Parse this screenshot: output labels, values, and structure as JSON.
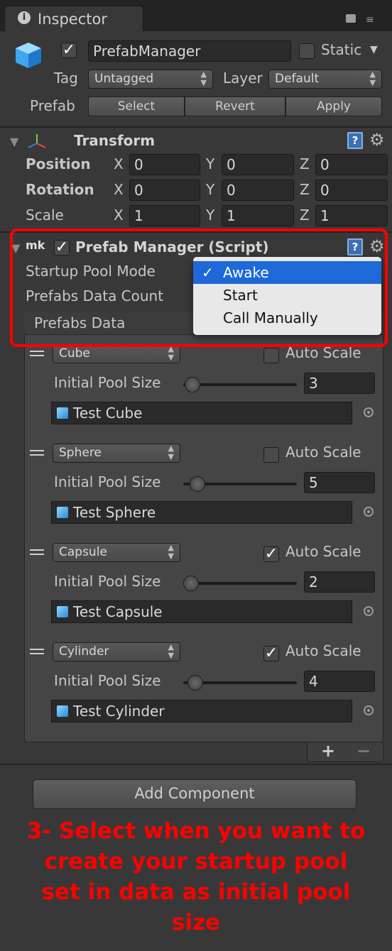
{
  "tab": {
    "title": "Inspector"
  },
  "header": {
    "object_name": "PrefabManager",
    "active_checked": true,
    "static_label": "Static",
    "tag_label": "Tag",
    "tag_value": "Untagged",
    "layer_label": "Layer",
    "layer_value": "Default",
    "prefab_label": "Prefab",
    "prefab_buttons": [
      "Select",
      "Revert",
      "Apply"
    ]
  },
  "transform": {
    "title": "Transform",
    "rows": [
      {
        "label": "Position",
        "x": "0",
        "y": "0",
        "z": "0"
      },
      {
        "label": "Rotation",
        "x": "0",
        "y": "0",
        "z": "0"
      },
      {
        "label": "Scale",
        "x": "1",
        "y": "1",
        "z": "1"
      }
    ],
    "axis": {
      "x": "X",
      "y": "Y",
      "z": "Z"
    }
  },
  "script_component": {
    "title": "Prefab Manager (Script)",
    "startup_label": "Startup Pool Mode",
    "count_label": "Prefabs Data Count",
    "list_title": "Prefabs Data",
    "dropdown_options": [
      "Awake",
      "Start",
      "Call Manually"
    ],
    "dropdown_selected": "Awake"
  },
  "entries": [
    {
      "type": "Cube",
      "auto_scale_label": "Auto Scale",
      "auto_scale": false,
      "pool_label": "Initial Pool Size",
      "pool_size": "3",
      "pool_fraction": 0.06,
      "prefab": "Test Cube"
    },
    {
      "type": "Sphere",
      "auto_scale_label": "Auto Scale",
      "auto_scale": false,
      "pool_label": "Initial Pool Size",
      "pool_size": "5",
      "pool_fraction": 0.1,
      "prefab": "Test Sphere"
    },
    {
      "type": "Capsule",
      "auto_scale_label": "Auto Scale",
      "auto_scale": true,
      "pool_label": "Initial Pool Size",
      "pool_size": "2",
      "pool_fraction": 0.04,
      "prefab": "Test Capsule"
    },
    {
      "type": "Cylinder",
      "auto_scale_label": "Auto Scale",
      "auto_scale": true,
      "pool_label": "Initial Pool Size",
      "pool_size": "4",
      "pool_fraction": 0.08,
      "prefab": "Test Cylinder"
    }
  ],
  "list_footer": {
    "add": "+",
    "remove": "−"
  },
  "add_component": "Add Component",
  "caption": {
    "lines": [
      "3- Select when you want to",
      "create your startup pool",
      "set in data as initial pool",
      "size"
    ]
  },
  "colors": {
    "highlight": "#ff0000",
    "selection": "#1e68d8",
    "panel": "#383838"
  }
}
